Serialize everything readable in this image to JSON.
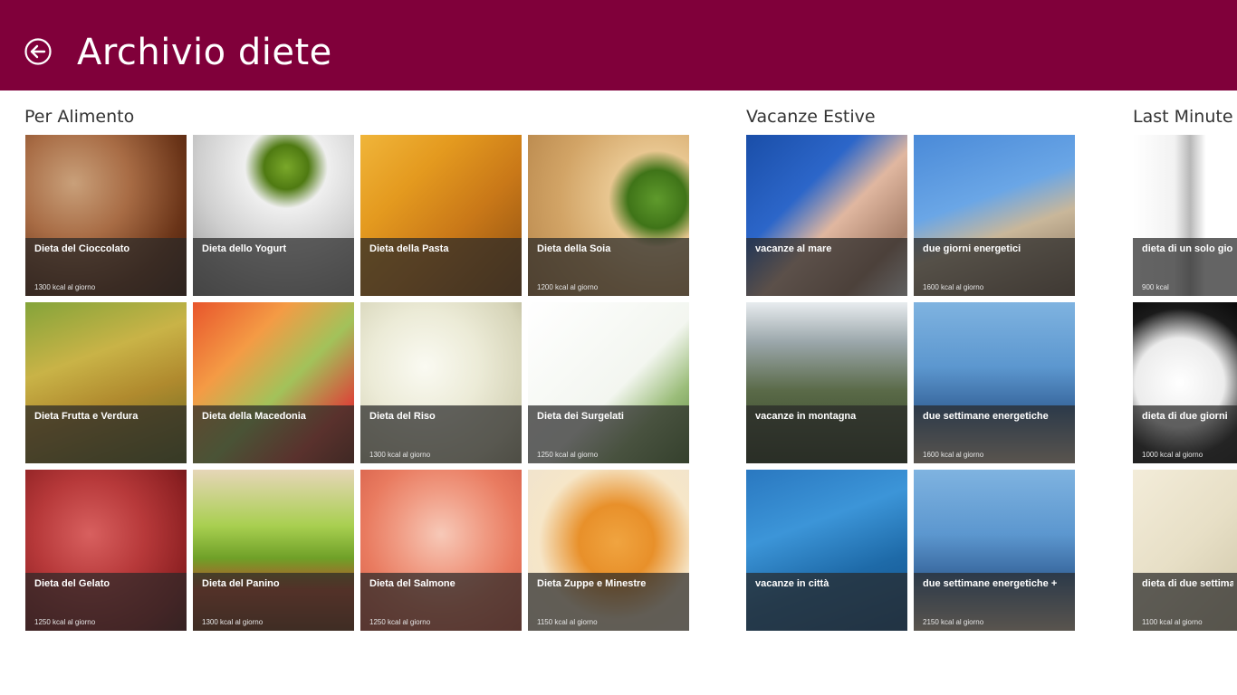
{
  "header": {
    "title": "Archivio diete",
    "back_icon": "back-arrow-circle-icon",
    "background": "#80003a"
  },
  "groups": [
    {
      "title": "Per Alimento",
      "tiles": [
        {
          "name": "Dieta del Cioccolato",
          "kcal": "1300 kcal al giorno"
        },
        {
          "name": "Dieta dello Yogurt",
          "kcal": ""
        },
        {
          "name": "Dieta della Pasta",
          "kcal": ""
        },
        {
          "name": "Dieta della Soia",
          "kcal": "1200 kcal al giorno"
        },
        {
          "name": "Dieta Frutta e Verdura",
          "kcal": ""
        },
        {
          "name": "Dieta della Macedonia",
          "kcal": ""
        },
        {
          "name": "Dieta del Riso",
          "kcal": "1300 kcal al giorno"
        },
        {
          "name": "Dieta dei Surgelati",
          "kcal": "1250 kcal al giorno"
        },
        {
          "name": "Dieta del Gelato",
          "kcal": "1250 kcal al giorno"
        },
        {
          "name": "Dieta del Panino",
          "kcal": "1300 kcal al giorno"
        },
        {
          "name": "Dieta del Salmone",
          "kcal": "1250 kcal al giorno"
        },
        {
          "name": "Dieta Zuppe e Minestre",
          "kcal": "1150 kcal al giorno"
        }
      ]
    },
    {
      "title": "Vacanze Estive",
      "tiles": [
        {
          "name": "vacanze al mare",
          "kcal": ""
        },
        {
          "name": "due giorni energetici",
          "kcal": "1600 kcal al giorno"
        },
        {
          "name": "vacanze in montagna",
          "kcal": ""
        },
        {
          "name": "due settimane energetiche",
          "kcal": "1600 kcal al giorno"
        },
        {
          "name": "vacanze in città",
          "kcal": ""
        },
        {
          "name": "due settimane energetiche +",
          "kcal": "2150 kcal al giorno"
        }
      ]
    },
    {
      "title": "Last Minute",
      "tiles": [
        {
          "name": "dieta di un solo giorno",
          "kcal": "900 kcal"
        },
        {
          "name": "dieta di due giorni",
          "kcal": "1000 kcal al giorno"
        },
        {
          "name": "dieta di due settimane",
          "kcal": "1100 kcal al giorno"
        }
      ]
    }
  ]
}
